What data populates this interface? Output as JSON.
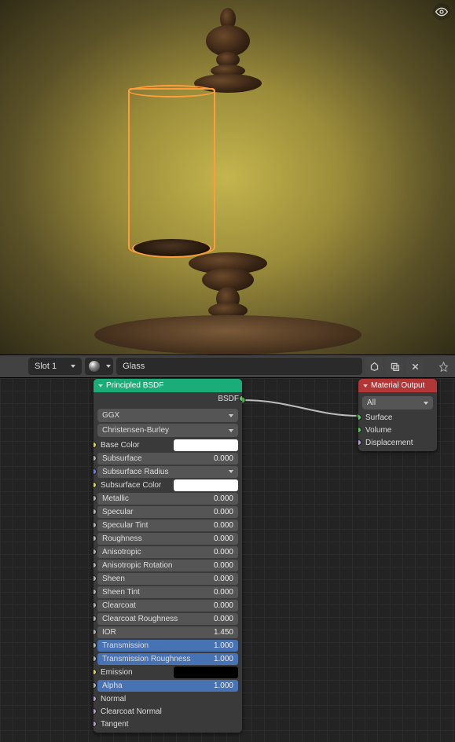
{
  "toolbar": {
    "slot_label": "Slot 1",
    "material_name": "Glass"
  },
  "nodes": {
    "principled": {
      "title": "Principled BSDF",
      "output": "BSDF",
      "distribution": "GGX",
      "subsurf_method": "Christensen-Burley",
      "rows": [
        {
          "name": "Base Color",
          "sock": "yellow",
          "type": "color",
          "color": "white"
        },
        {
          "name": "Subsurface",
          "sock": "grey",
          "type": "num",
          "value": "0.000"
        },
        {
          "name": "Subsurface Radius",
          "sock": "blue",
          "type": "expand"
        },
        {
          "name": "Subsurface Color",
          "sock": "yellow",
          "type": "color",
          "color": "white"
        },
        {
          "name": "Metallic",
          "sock": "grey",
          "type": "num",
          "value": "0.000"
        },
        {
          "name": "Specular",
          "sock": "grey",
          "type": "num",
          "value": "0.000"
        },
        {
          "name": "Specular Tint",
          "sock": "grey",
          "type": "num",
          "value": "0.000"
        },
        {
          "name": "Roughness",
          "sock": "grey",
          "type": "num",
          "value": "0.000"
        },
        {
          "name": "Anisotropic",
          "sock": "grey",
          "type": "num",
          "value": "0.000"
        },
        {
          "name": "Anisotropic Rotation",
          "sock": "grey",
          "type": "num",
          "value": "0.000"
        },
        {
          "name": "Sheen",
          "sock": "grey",
          "type": "num",
          "value": "0.000"
        },
        {
          "name": "Sheen Tint",
          "sock": "grey",
          "type": "num",
          "value": "0.000"
        },
        {
          "name": "Clearcoat",
          "sock": "grey",
          "type": "num",
          "value": "0.000"
        },
        {
          "name": "Clearcoat Roughness",
          "sock": "grey",
          "type": "num",
          "value": "0.000"
        },
        {
          "name": "IOR",
          "sock": "grey",
          "type": "num",
          "value": "1.450"
        },
        {
          "name": "Transmission",
          "sock": "grey",
          "type": "num",
          "value": "1.000",
          "active": true
        },
        {
          "name": "Transmission Roughness",
          "sock": "grey",
          "type": "num",
          "value": "1.000",
          "active": true
        },
        {
          "name": "Emission",
          "sock": "yellow",
          "type": "color",
          "color": "black"
        },
        {
          "name": "Alpha",
          "sock": "grey",
          "type": "num",
          "value": "1.000",
          "active": true
        },
        {
          "name": "Normal",
          "sock": "lav",
          "type": "label"
        },
        {
          "name": "Clearcoat Normal",
          "sock": "lav",
          "type": "label"
        },
        {
          "name": "Tangent",
          "sock": "lav",
          "type": "label"
        }
      ]
    },
    "output": {
      "title": "Material Output",
      "target": "All",
      "inputs": [
        {
          "name": "Surface",
          "sock": "green"
        },
        {
          "name": "Volume",
          "sock": "green"
        },
        {
          "name": "Displacement",
          "sock": "lav"
        }
      ]
    }
  }
}
